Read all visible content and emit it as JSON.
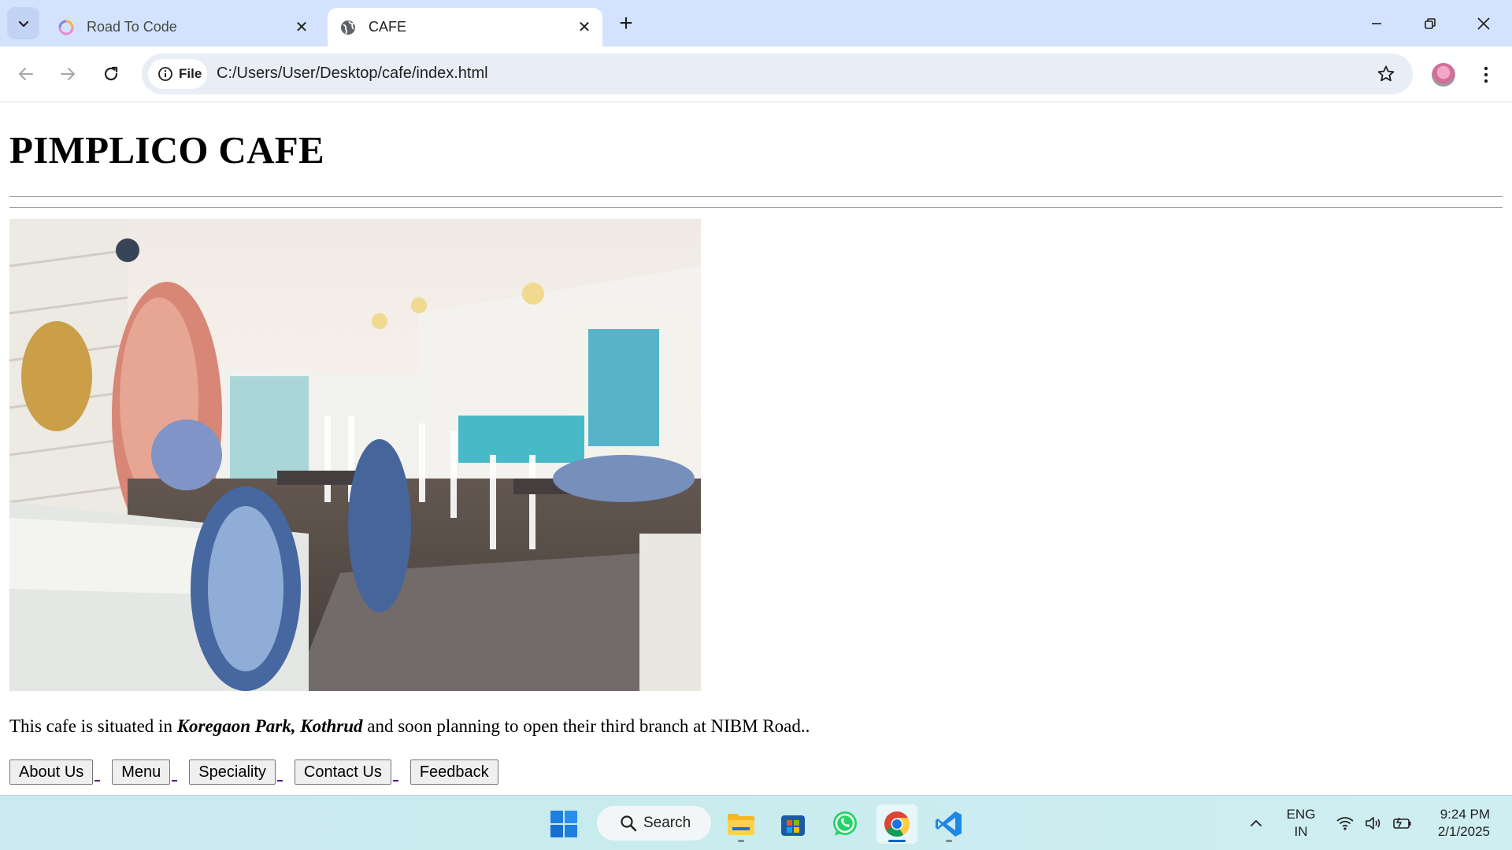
{
  "browser": {
    "tabs": [
      {
        "title": "Road To Code",
        "active": false
      },
      {
        "title": "CAFE",
        "active": true
      }
    ],
    "address": {
      "chip_label": "File",
      "url": "C:/Users/User/Desktop/cafe/index.html"
    }
  },
  "page": {
    "heading": "PIMPLICO CAFE",
    "description": {
      "before": "This cafe is situated in ",
      "emphasis": "Koregaon Park, Kothrud",
      "after": " and soon planning to open their third branch at NIBM Road.."
    },
    "buttons": [
      "About Us",
      "Menu",
      "Speciality",
      "Contact Us",
      "Feedback"
    ]
  },
  "taskbar": {
    "search_label": "Search",
    "language": {
      "line1": "ENG",
      "line2": "IN"
    },
    "clock": {
      "time": "9:24 PM",
      "date": "2/1/2025"
    }
  },
  "colors": {
    "tabstrip": "#d3e3fd",
    "omnibox": "#e9eef6",
    "visited_link": "#551a8b"
  }
}
